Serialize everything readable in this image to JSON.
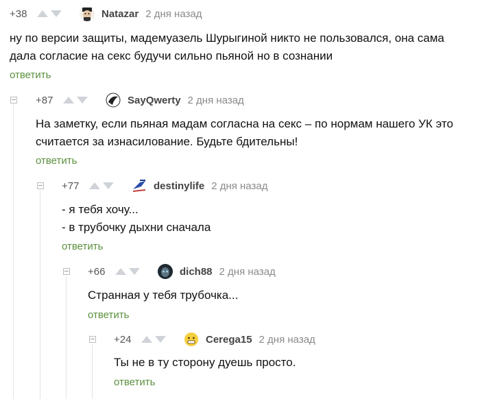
{
  "comments": [
    {
      "rating": "+38",
      "author": "Natazar",
      "time": "2 дня назад",
      "lines": [
        "ну по версии защиты, мадемуазель Шурыгиной никто не пользовался, она сама",
        "дала согласие на секс будучи сильно пьяной но в сознании"
      ],
      "reply": "ответить"
    },
    {
      "rating": "+87",
      "author": "SayQwerty",
      "time": "2 дня назад",
      "lines": [
        "На заметку, если пьяная мадам согласна на секс – по нормам нашего УК это",
        "считается за изнасилование. Будьте бдительны!"
      ],
      "reply": "ответить"
    },
    {
      "rating": "+77",
      "author": "destinylife",
      "time": "2 дня назад",
      "lines": [
        "- я тебя хочу...",
        "- в трубочку дыхни сначала"
      ],
      "reply": "ответить"
    },
    {
      "rating": "+66",
      "author": "dich88",
      "time": "2 дня назад",
      "lines": [
        "Странная у тебя трубочка..."
      ],
      "reply": "ответить"
    },
    {
      "rating": "+24",
      "author": "Cerega15",
      "time": "2 дня назад",
      "lines": [
        "Ты не в ту сторону дуешь просто."
      ],
      "reply": "ответить"
    }
  ],
  "icons": {
    "upvote": "arrow-up-icon",
    "downvote": "arrow-down-icon",
    "collapse": "collapse-minus-icon"
  }
}
